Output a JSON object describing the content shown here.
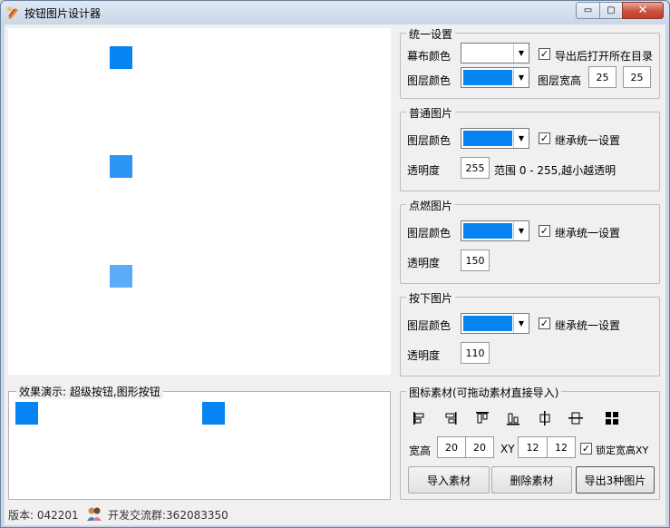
{
  "window": {
    "title": "按钮图片设计器",
    "min_glyph": "▭",
    "max_glyph": "▢",
    "close_glyph": "✕"
  },
  "colors": {
    "layer_blue": "#0884f2",
    "mid_blue": "#2c96f4",
    "light_blue": "#5aacf6",
    "white": "#ffffff"
  },
  "preview": {
    "legend": "效果演示: 超级按钮,图形按钮"
  },
  "unified": {
    "legend": "统一设置",
    "canvas_color_label": "幕布颜色",
    "layer_color_label": "图层颜色",
    "open_dir_label": "导出后打开所在目录",
    "open_dir_checked": true,
    "size_label": "图层宽高",
    "width": "25",
    "height": "25"
  },
  "normal": {
    "legend": "普通图片",
    "layer_color_label": "图层颜色",
    "inherit_label": "继承统一设置",
    "inherit_checked": true,
    "opacity_label": "透明度",
    "opacity": "255",
    "range_text": "范围 0 - 255,越小越透明"
  },
  "hover": {
    "legend": "点燃图片",
    "layer_color_label": "图层颜色",
    "inherit_label": "继承统一设置",
    "inherit_checked": true,
    "opacity_label": "透明度",
    "opacity": "150"
  },
  "pressed": {
    "legend": "按下图片",
    "layer_color_label": "图层颜色",
    "inherit_label": "继承统一设置",
    "inherit_checked": true,
    "opacity_label": "透明度",
    "opacity": "110"
  },
  "material": {
    "legend": "图标素材(可拖动素材直接导入)",
    "size_label": "宽高",
    "w": "20",
    "h": "20",
    "xy_label": "XY",
    "x": "12",
    "y": "12",
    "lock_label": "锁定宽高XY",
    "lock_checked": true,
    "import_btn": "导入素材",
    "delete_btn": "删除素材",
    "export_btn": "导出3种图片",
    "icons": [
      "align-left-icon",
      "align-right-icon",
      "align-top-icon",
      "align-bottom-icon",
      "align-hcenter-icon",
      "align-vcenter-icon",
      "grid-icon"
    ]
  },
  "status": {
    "version": "版本: 042201",
    "group": "开发交流群:362083350"
  }
}
